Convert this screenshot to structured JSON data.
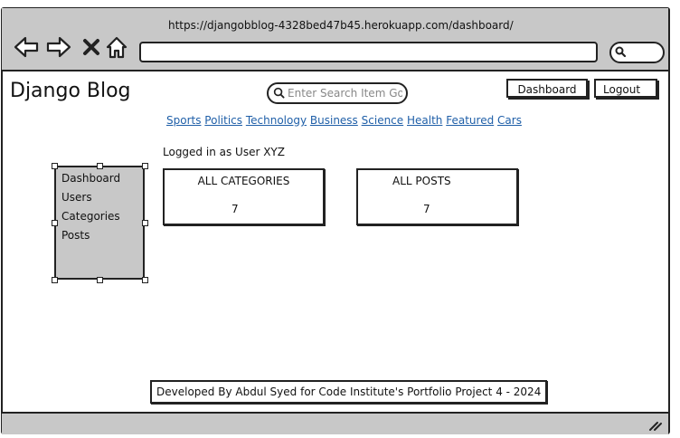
{
  "browser": {
    "url": "https://djangobblog-4328bed47b45.herokuapp.com/dashboard/"
  },
  "header": {
    "brand": "Django Blog",
    "search_placeholder": "Enter Search Item Go",
    "dashboard_label": "Dashboard",
    "logout_label": "Logout"
  },
  "categories": [
    "Sports",
    "Politics",
    "Technology",
    "Business",
    "Science",
    "Health",
    "Featured",
    "Cars"
  ],
  "user_status": "Logged in as User XYZ",
  "sidebar": {
    "items": [
      {
        "label": "Dashboard"
      },
      {
        "label": "Users"
      },
      {
        "label": "Categories"
      },
      {
        "label": "Posts"
      }
    ]
  },
  "cards": {
    "categories": {
      "title": "ALL CATEGORIES",
      "count": "7"
    },
    "posts": {
      "title": "ALL POSTS",
      "count": "7"
    }
  },
  "footer": {
    "text": "Developed By Abdul Syed for Code Institute's Portfolio Project 4 - 2024"
  },
  "colors": {
    "chrome": "#c8c8c8",
    "link": "#1f5fa8",
    "border": "#222222"
  }
}
